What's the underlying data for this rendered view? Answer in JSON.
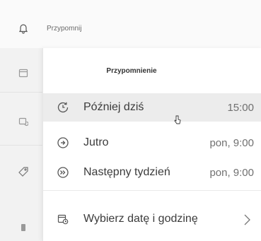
{
  "reminder": {
    "label": "Przypomnij"
  },
  "flyout": {
    "title": "Przypomnienie",
    "options": [
      {
        "label": "Później dziś",
        "time": "15:00"
      },
      {
        "label": "Jutro",
        "time": "pon, 9:00"
      },
      {
        "label": "Następny tydzień",
        "time": "pon, 9:00"
      }
    ],
    "pick": {
      "label": "Wybierz datę i godzinę"
    }
  },
  "icons": {
    "bell": "bell-icon",
    "calendar": "calendar-icon",
    "calendar_repeat": "calendar-repeat-icon",
    "tag": "tag-icon",
    "file": "file-icon",
    "clock": "clock-arrow-icon",
    "arrow_right_circle": "arrow-right-circle-icon",
    "double_arrow_circle": "double-arrow-circle-icon",
    "calendar_clock": "calendar-clock-icon",
    "chevron": "chevron-right-icon"
  },
  "colors": {
    "hover_bg": "#ececec",
    "panel_bg": "#f2f2f2",
    "flyout_bg": "#ffffff"
  }
}
